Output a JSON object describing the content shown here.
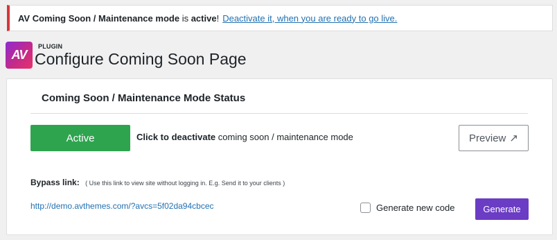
{
  "notice": {
    "plugin_name": "AV Coming Soon / Maintenance mode",
    "middle": "is",
    "state": "active",
    "suffix": "!",
    "link_text": "Deactivate it, when you are ready to go live."
  },
  "header": {
    "logo_text": "AV",
    "plugin_label": "PLUGIN",
    "title": "Configure Coming Soon Page"
  },
  "status_panel": {
    "title": "Coming Soon / Maintenance Mode Status",
    "active_button": "Active",
    "hint_bold": "Click to deactivate",
    "hint_rest": "coming soon / maintenance mode",
    "preview_button": "Preview",
    "preview_icon": "↗"
  },
  "bypass": {
    "label": "Bypass link:",
    "hint": "( Use this link to view site without logging in. E.g. Send it to your clients )",
    "url": "http://demo.avthemes.com/?avcs=5f02da94cbcec",
    "generate_new_label": "Generate new code",
    "generate_new_checked": false,
    "generate_button": "Generate"
  },
  "colors": {
    "notice_border": "#d63638",
    "link": "#2271b1",
    "active": "#2ea44f",
    "generate": "#6b3cc4"
  }
}
